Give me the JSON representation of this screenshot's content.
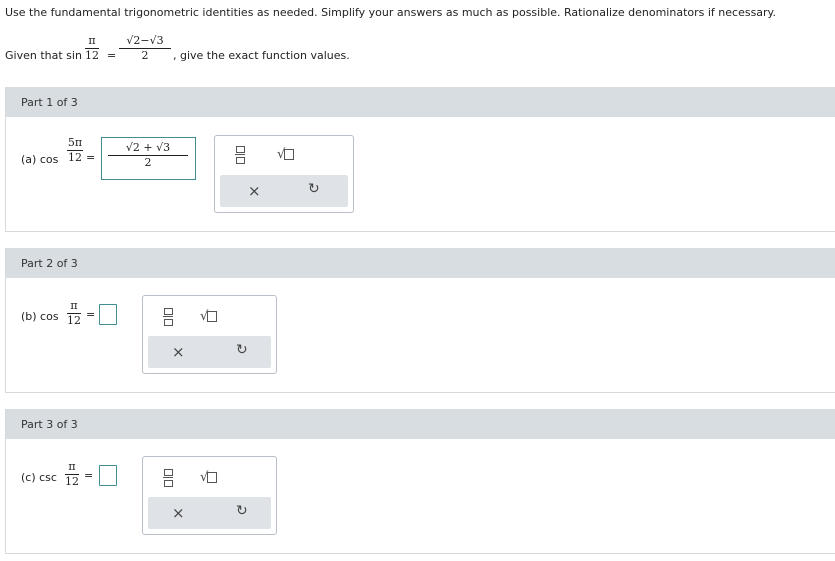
{
  "instructions": "Use the fundamental trigonometric identities as needed. Simplify your answers as much as possible. Rationalize denominators if necessary.",
  "given": {
    "prefix": "Given that sin",
    "angle_num": "π",
    "angle_den": "12",
    "equals": "=",
    "value_num": "√2−√3",
    "value_den": "2",
    "suffix": ", give the exact function values."
  },
  "parts": [
    {
      "header": "Part 1 of 3",
      "label": "(a) cos",
      "angle_num": "5π",
      "angle_den": "12",
      "equals": "=",
      "answer_num": "√2 + √3",
      "answer_den": "2"
    },
    {
      "header": "Part 2 of 3",
      "label": "(b) cos",
      "angle_num": "π",
      "angle_den": "12",
      "equals": "=",
      "answer": ""
    },
    {
      "header": "Part 3 of 3",
      "label": "(c) csc",
      "angle_num": "π",
      "angle_den": "12",
      "equals": "=",
      "answer": ""
    }
  ],
  "toolbox": {
    "fraction_icon": "fraction-template-icon",
    "sqrt_icon": "square-root-template-icon",
    "clear_symbol": "×",
    "undo_symbol": "↻"
  },
  "colors": {
    "header_bg": "#d8dde2",
    "answer_border": "#3f8f92",
    "tool_bottom_bg": "#dfe3e8"
  }
}
